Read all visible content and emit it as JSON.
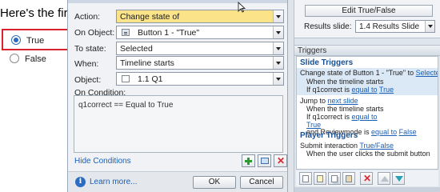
{
  "slide": {
    "heading": "Here's the first",
    "options": [
      {
        "label": "True",
        "selected": true
      },
      {
        "label": "False",
        "selected": false
      }
    ]
  },
  "dialog": {
    "action": {
      "label": "Action:",
      "value": "Change state of"
    },
    "on_object": {
      "label": "On Object:",
      "value": "Button 1 - \"True\""
    },
    "to_state": {
      "label": "To state:",
      "value": "Selected"
    },
    "when": {
      "label": "When:",
      "value": "Timeline starts"
    },
    "object": {
      "label": "Object:",
      "value": "1.1 Q1"
    },
    "on_condition": {
      "label": "On Condition:",
      "value": "q1correct == Equal to True"
    },
    "hide_conditions": "Hide Conditions",
    "learn_more": "Learn more...",
    "ok": "OK",
    "cancel": "Cancel",
    "info_glyph": "i"
  },
  "right_panel": {
    "edit_button": "Edit True/False",
    "results_label": "Results slide:",
    "results_value": "1.4 Results Slide",
    "triggers_title": "Triggers",
    "slide_triggers_title": "Slide Triggers",
    "trigger1": {
      "line1_prefix": "Change state of Button 1 - \"True\" to ",
      "line1_link": "Selected",
      "line2": "When the timeline starts",
      "line3_prefix": "If q1correct is ",
      "line3_link1": "equal to",
      "line3_link2": "True"
    },
    "trigger2": {
      "line1_prefix": "Jump to ",
      "line1_link": "next slide",
      "line2": "When the timeline starts",
      "line3_prefix": "If q1correct is ",
      "line3_link1": "equal to",
      "line3_link2": "True",
      "line4_prefix": "and Reviewmode is ",
      "line4_link1": "equal to",
      "line4_link2": "False"
    },
    "player_triggers_title": "Player Triggers",
    "trigger3": {
      "line1_prefix": "Submit interaction ",
      "line1_link": "True/False",
      "line2": "When the user clicks the submit button"
    }
  },
  "colors": {
    "highlight_border": "#d9232c",
    "action_field": "#fbe38a",
    "link": "#1a5fb4",
    "section_title": "#1a4f8f"
  },
  "icons": {
    "add": "plus-icon",
    "edit": "edit-icon",
    "delete": "delete-icon",
    "info": "info-icon"
  }
}
